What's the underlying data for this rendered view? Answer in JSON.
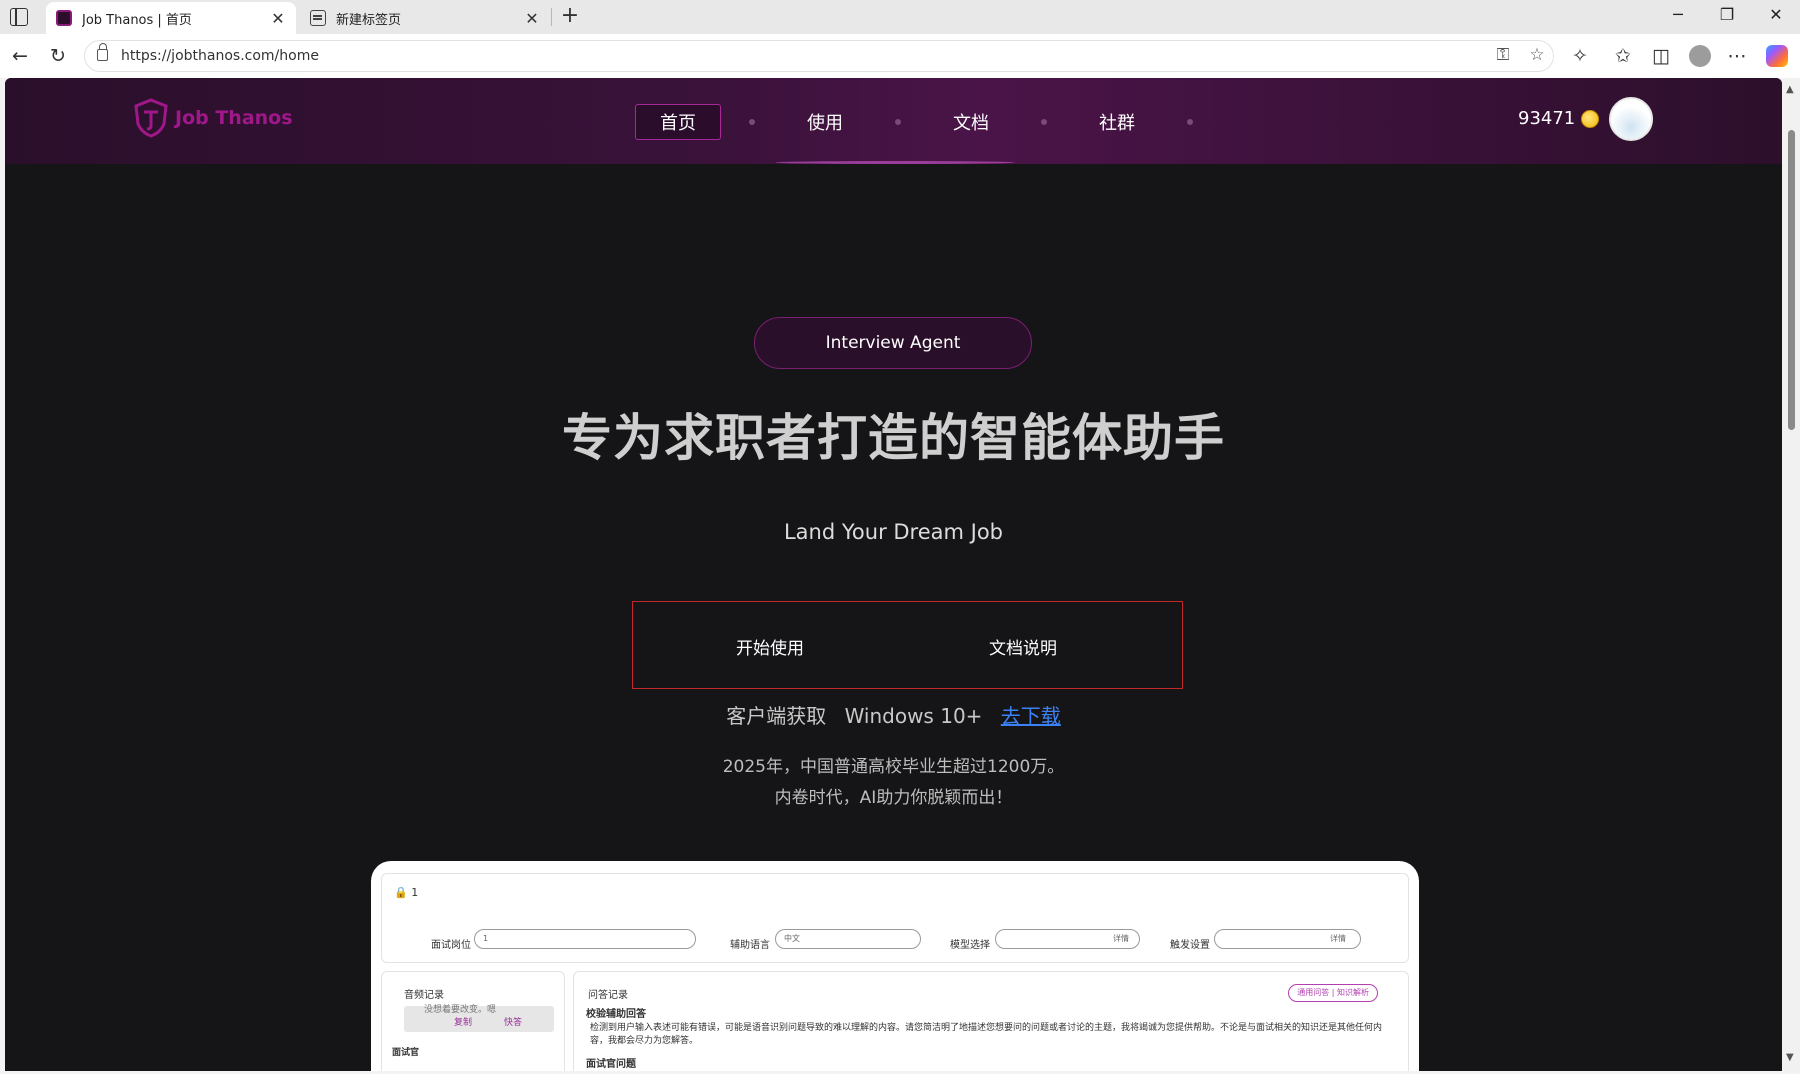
{
  "browser": {
    "tabs": [
      {
        "title": "Job Thanos | 首页",
        "active": true
      },
      {
        "title": "新建标签页",
        "active": false
      }
    ],
    "url": "https://jobthanos.com/home"
  },
  "site": {
    "logo_text": "Job Thanos",
    "nav": [
      {
        "label": "首页",
        "active": true
      },
      {
        "label": "使用"
      },
      {
        "label": "文档"
      },
      {
        "label": "社群"
      }
    ],
    "coins": "93471"
  },
  "hero": {
    "badge": "Interview Agent",
    "title": "专为求职者打造的智能体助手",
    "subtitle": "Land Your Dream Job",
    "cta_start": "开始使用",
    "cta_docs": "文档说明",
    "download_label": "客户端获取",
    "download_platform": "Windows 10+",
    "download_link": "去下载",
    "desc_line1": "2025年，中国普通高校毕业生超过1200万。",
    "desc_line2": "内卷时代，AI助力你脱颖而出！"
  },
  "preview": {
    "session": "1",
    "fields": {
      "position_label": "面试岗位",
      "position_value": "1",
      "language_label": "辅助语言",
      "language_value": "中文",
      "model_label": "模型选择",
      "model_detail": "详情",
      "trigger_label": "触发设置",
      "trigger_detail": "详情"
    },
    "audio_panel": {
      "title": "音频记录",
      "snippet": "没想着要改变。嗯",
      "copy": "复制",
      "quick": "快答",
      "interviewer": "面试官"
    },
    "qa_panel": {
      "title": "问答记录",
      "tags": "通用问答 | 知识解析",
      "section_title": "校验辅助回答",
      "body": "检测到用户输入表述可能有错误，可能是语音识别问题导致的难以理解的内容。请您简洁明了地描述您想要问的问题或者讨论的主题，我将竭诚为您提供帮助。不论是与面试相关的知识还是其他任何内容，我都会尽力为您解答。",
      "question_title": "面试官问题"
    }
  }
}
